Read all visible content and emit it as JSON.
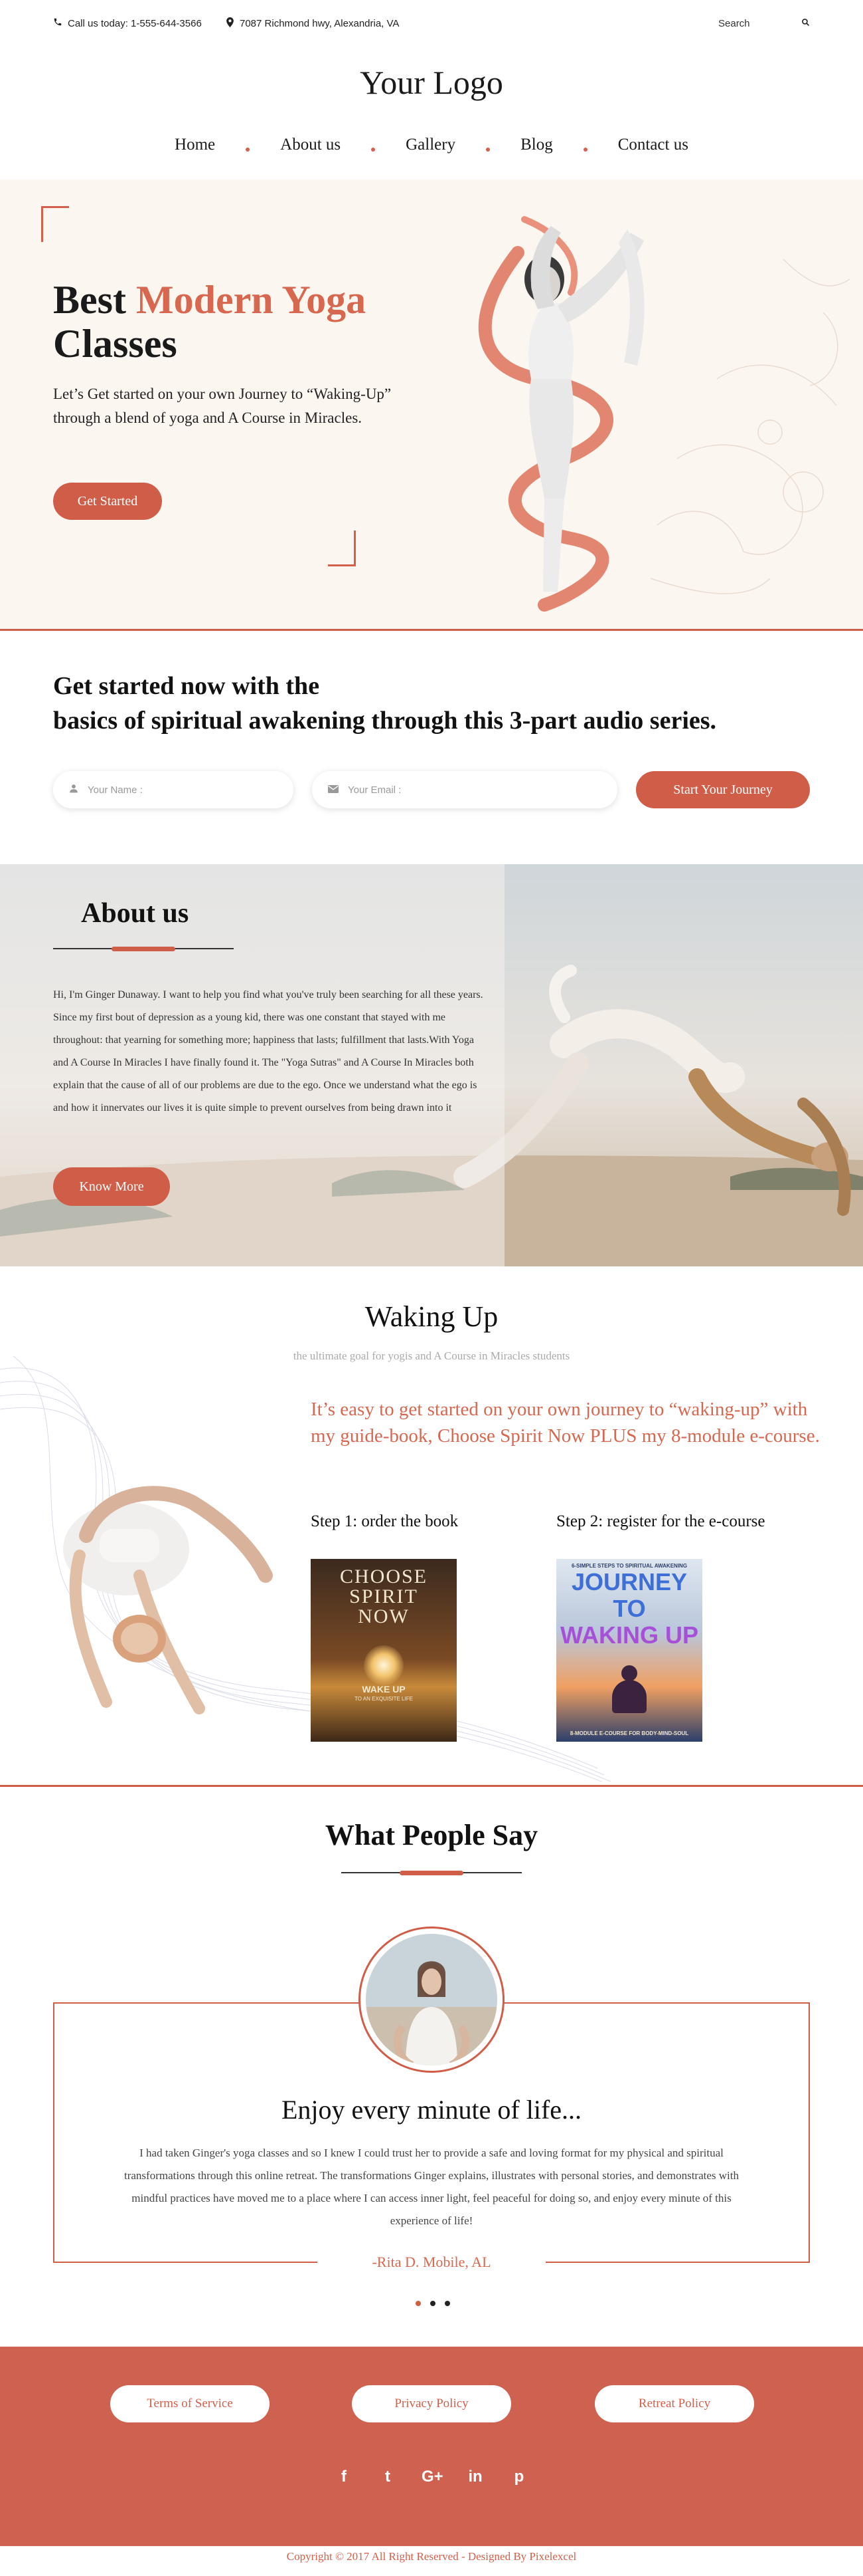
{
  "topbar": {
    "phone": "Call us today: 1-555-644-3566",
    "address": "7087 Richmond hwy, Alexandria, VA",
    "search_label": "Search"
  },
  "logo": "Your Logo",
  "nav": {
    "items": [
      "Home",
      "About us",
      "Gallery",
      "Blog",
      "Contact us"
    ]
  },
  "hero": {
    "title_part1": "Best ",
    "title_accent": "Modern Yoga",
    "title_part2": "Classes",
    "description": "Let’s Get started on your own Journey to “Waking-Up” through a blend of yoga and A Course in Miracles.",
    "button": "Get Started"
  },
  "get_started": {
    "title_line1": "Get started now with the",
    "title_line2": "basics of spiritual awakening through this 3-part audio series.",
    "name_placeholder": "Your Name :",
    "email_placeholder": "Your Email :",
    "button": "Start Your Journey"
  },
  "about": {
    "title": "About us",
    "body": "Hi, I'm Ginger Dunaway. I want to help you find what you've truly been searching for all these years. Since my first bout of depression as a young kid, there was one constant that stayed with me throughout: that yearning for something more; happiness that lasts; fulfillment that lasts.With Yoga and A Course In Miracles I have finally found it. The \"Yoga Sutras\" and A Course In Miracles both explain that the cause of all of our problems are due to the ego. Once we understand what the ego is and how it innervates our lives it is quite simple to prevent ourselves from being drawn into it",
    "button": "Know More"
  },
  "waking_up": {
    "title": "Waking Up",
    "subtitle": "the ultimate goal for yogis and A Course in Miracles students",
    "lead": "It’s easy to get started on your own journey to “waking-up” with my guide-book, Choose Spirit Now PLUS my 8-module e-course.",
    "step1": "Step 1: order the book",
    "step2": "Step 2: register for the e-course",
    "book1": {
      "title_line1": "CHOOSE",
      "title_line2": "SPIRIT",
      "title_line3": "NOW",
      "tagline": "WAKE UP",
      "tagline2": "TO AN EXQUISITE LIFE"
    },
    "book2": {
      "header": "6-SIMPLE STEPS TO SPIRITUAL AWAKENING",
      "title_line1": "JOURNEY TO",
      "title_line2": "WAKING UP",
      "footer": "8-MODULE E-COURSE FOR BODY-MIND-SOUL"
    }
  },
  "testimonials": {
    "title": "What People Say",
    "quote_title": "Enjoy every minute of life...",
    "quote": "I had taken Ginger's yoga classes and so I knew I could trust her to provide a safe and loving format for my physical and spiritual transformations through this online retreat. The transformations Ginger explains, illustrates with personal stories, and demonstrates with mindful practices have moved me to a place where I can access inner light, feel peaceful for doing so, and enjoy every minute of this experience of life!",
    "author": "-Rita D.  Mobile, AL",
    "active_slide": 1,
    "slide_count": 3
  },
  "footer": {
    "links": [
      "Terms of Service",
      "Privacy Policy",
      "Retreat Policy"
    ],
    "socials": [
      {
        "icon": "facebook-icon",
        "glyph": "f"
      },
      {
        "icon": "twitter-icon",
        "glyph": "t"
      },
      {
        "icon": "google-plus-icon",
        "glyph": "G+"
      },
      {
        "icon": "linkedin-icon",
        "glyph": "in"
      },
      {
        "icon": "pinterest-icon",
        "glyph": "p"
      }
    ],
    "copyright": "Copyright © 2017 All Right Reserved - Designed By Pixelexcel"
  },
  "colors": {
    "accent": "#cf5d48",
    "hero_bg": "#fcf6f1",
    "footer_bg": "#cf6150"
  }
}
